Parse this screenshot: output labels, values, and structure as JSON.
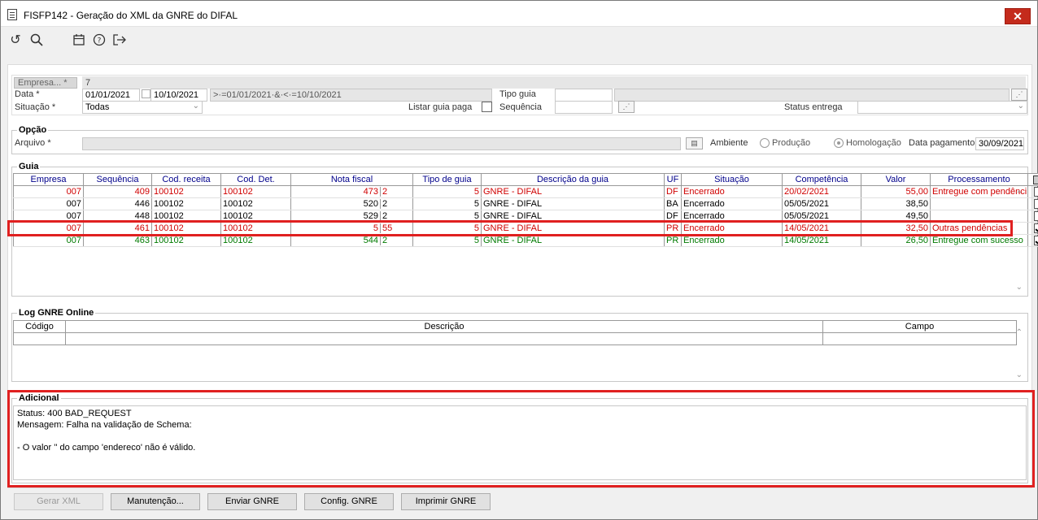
{
  "window": {
    "title": "FISFP142 - Geração do XML da GNRE do DIFAL",
    "close": "✕"
  },
  "toolbar": {
    "icons": [
      "refresh-icon",
      "search-icon",
      "calendar-icon",
      "help-icon",
      "exit-icon"
    ]
  },
  "filters": {
    "empresa_btn": "Empresa... *",
    "empresa_value": "7",
    "data_label": "Data *",
    "data_from": "01/01/2021",
    "data_to": "10/10/2021",
    "data_expr": ">·=01/01/2021·&·<·=10/10/2021",
    "tipo_guia_label": "Tipo guia",
    "tipo_guia_value": "",
    "situacao_label": "Situação *",
    "situacao_value": "Todas",
    "listar_label": "Listar guia paga",
    "sequencia_label": "Sequência",
    "sequencia_value": "",
    "status_entrega_label": "Status entrega",
    "status_entrega_value": ""
  },
  "opcao": {
    "legend": "Opção",
    "arquivo_label": "Arquivo *",
    "arquivo_value": "",
    "ambiente_label": "Ambiente",
    "producao_label": "Produção",
    "homologacao_label": "Homologação",
    "data_pag_label": "Data pagamento",
    "data_pag_value": "30/09/2021"
  },
  "guia": {
    "legend": "Guia",
    "columns": [
      "Empresa",
      "Sequência",
      "Cod. receita",
      "Cod. Det.",
      "Nota fiscal",
      "Tipo de guia",
      "Descrição da guia",
      "UF",
      "Situação",
      "Competência",
      "Valor",
      "Processamento"
    ],
    "rows": [
      {
        "color": "red",
        "empresa": "007",
        "seq": "409",
        "cod_rec": "100102",
        "cod_det": "100102",
        "nf": "473",
        "serie": "2",
        "tipo": "5",
        "desc": "GNRE - DIFAL",
        "uf": "DF",
        "sit": "Encerrado",
        "comp": "20/02/2021",
        "valor": "55,00",
        "proc": "Entregue com pendênci",
        "checked": false
      },
      {
        "color": "black",
        "empresa": "007",
        "seq": "446",
        "cod_rec": "100102",
        "cod_det": "100102",
        "nf": "520",
        "serie": "2",
        "tipo": "5",
        "desc": "GNRE - DIFAL",
        "uf": "BA",
        "sit": "Encerrado",
        "comp": "05/05/2021",
        "valor": "38,50",
        "proc": "",
        "checked": false
      },
      {
        "color": "black",
        "empresa": "007",
        "seq": "448",
        "cod_rec": "100102",
        "cod_det": "100102",
        "nf": "529",
        "serie": "2",
        "tipo": "5",
        "desc": "GNRE - DIFAL",
        "uf": "DF",
        "sit": "Encerrado",
        "comp": "05/05/2021",
        "valor": "49,50",
        "proc": "",
        "checked": false
      },
      {
        "color": "red",
        "empresa": "007",
        "seq": "461",
        "cod_rec": "100102",
        "cod_det": "100102",
        "nf": "5",
        "serie": "55",
        "tipo": "5",
        "desc": "GNRE - DIFAL",
        "uf": "PR",
        "sit": "Encerrado",
        "comp": "14/05/2021",
        "valor": "32,50",
        "proc": "Outras pendências",
        "checked": true
      },
      {
        "color": "green",
        "empresa": "007",
        "seq": "463",
        "cod_rec": "100102",
        "cod_det": "100102",
        "nf": "544",
        "serie": "2",
        "tipo": "5",
        "desc": "GNRE - DIFAL",
        "uf": "PR",
        "sit": "Encerrado",
        "comp": "14/05/2021",
        "valor": "26,50",
        "proc": "Entregue com sucesso",
        "checked": true
      }
    ]
  },
  "log": {
    "legend": "Log GNRE Online",
    "columns": [
      "Código",
      "Descrição",
      "Campo"
    ]
  },
  "adicional": {
    "legend": "Adicional",
    "text": "Status: 400 BAD_REQUEST\nMensagem: Falha na validação de Schema:\n\n- O valor '' do campo 'endereco' não é válido."
  },
  "buttons": {
    "gerar": "Gerar XML",
    "manutencao": "Manutenção...",
    "enviar": "Enviar GNRE",
    "config": "Config. GNRE",
    "imprimir": "Imprimir GNRE"
  },
  "colors": {
    "highlight": "#e02020",
    "red_text": "#d00000",
    "green_text": "#007a00",
    "header_text": "#00008b"
  }
}
